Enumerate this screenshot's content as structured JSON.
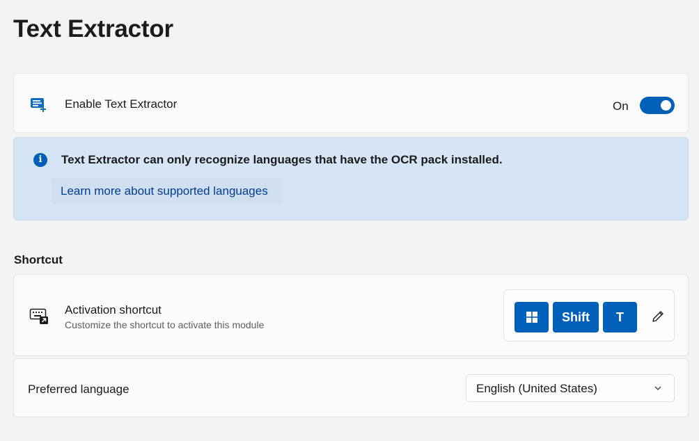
{
  "page": {
    "title": "Text Extractor"
  },
  "enable": {
    "label": "Enable Text Extractor",
    "toggle_state": "On",
    "icon": "text-extractor-icon"
  },
  "info": {
    "icon": "info-icon",
    "glyph": "i",
    "message": "Text Extractor can only recognize languages that have the OCR pack installed.",
    "link": "Learn more about supported languages"
  },
  "shortcut": {
    "section_header": "Shortcut",
    "title": "Activation shortcut",
    "description": "Customize the shortcut to activate this module",
    "keys": [
      "win-key",
      "Shift",
      "T"
    ],
    "edit_icon": "pencil-icon"
  },
  "language": {
    "label": "Preferred language",
    "selected": "English (United States)"
  },
  "colors": {
    "accent": "#005fb8",
    "info_background": "#d5e5f6",
    "link": "#003e92"
  }
}
